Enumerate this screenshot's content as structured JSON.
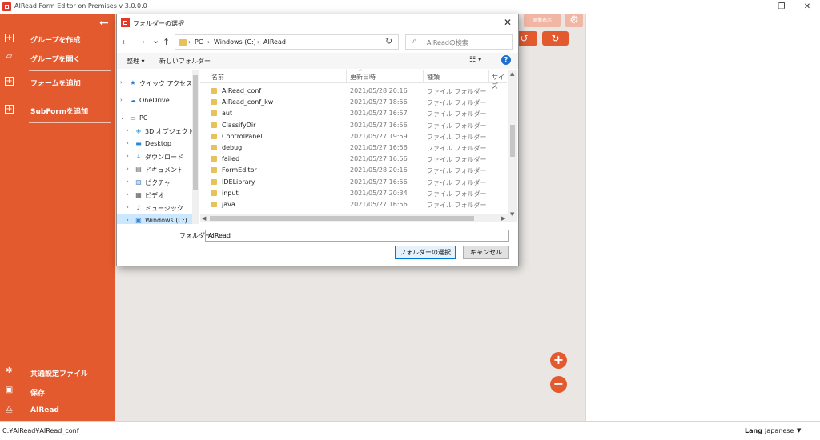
{
  "app": {
    "title": "AIRead Form Editor on Premises v 3.0.0.0",
    "window_controls": [
      "─",
      "❐",
      "✕"
    ]
  },
  "sidebar": {
    "back_glyph": "←",
    "items": [
      {
        "label": "グループを作成",
        "icon": "plus-box-icon"
      },
      {
        "label": "グループを開く",
        "icon": "folder-open-icon"
      },
      {
        "label": "フォームを追加",
        "icon": "plus-box-icon"
      },
      {
        "label": "SubFormを追加",
        "icon": "plus-box-icon"
      }
    ],
    "bottom": [
      {
        "label": "共通設定ファイル",
        "icon": "gear-icon"
      },
      {
        "label": "保存",
        "icon": "save-icon"
      },
      {
        "label": "AIRead",
        "icon": "airead-logo-icon"
      }
    ]
  },
  "toolbar": {
    "faded_button": "画像表示",
    "gear_glyph": "⚙",
    "undo_glyph": "↺",
    "redo_glyph": "↻",
    "zoom_in_glyph": "+",
    "zoom_out_glyph": "−"
  },
  "statusbar": {
    "path": "C:¥AIRead¥AIRead_conf",
    "lang_label": "Lang :",
    "lang_value": "Japanese",
    "dropdown_glyph": "▼"
  },
  "dialog": {
    "title": "フォルダーの選択",
    "close_glyph": "✕",
    "nav": {
      "back": "←",
      "forward": "→",
      "recent": "⌄",
      "up": "↑"
    },
    "breadcrumb": [
      "PC",
      "Windows (C:)",
      "AIRead"
    ],
    "crumb_sep": "›",
    "refresh_glyph": "↻",
    "search_glyph": "⌕",
    "search_placeholder": "AIReadの検索",
    "commands": {
      "organize": "整理 ▾",
      "new_folder": "新しいフォルダー",
      "view_glyph": "☷ ▾",
      "help_glyph": "?"
    },
    "tree": [
      {
        "label": "クイック アクセス",
        "icon": "★",
        "indent": 0,
        "expander": "›"
      },
      {
        "label": "OneDrive",
        "icon": "☁",
        "indent": 0,
        "expander": "›"
      },
      {
        "label": "PC",
        "icon": "▭",
        "indent": 0,
        "expander": "⌄"
      },
      {
        "label": "3D オブジェクト",
        "icon": "◈",
        "indent": 1,
        "expander": "›"
      },
      {
        "label": "Desktop",
        "icon": "▬",
        "indent": 1,
        "expander": "›"
      },
      {
        "label": "ダウンロード",
        "icon": "↓",
        "indent": 1,
        "expander": "›"
      },
      {
        "label": "ドキュメント",
        "icon": "▤",
        "indent": 1,
        "expander": "›"
      },
      {
        "label": "ピクチャ",
        "icon": "▨",
        "indent": 1,
        "expander": "›"
      },
      {
        "label": "ビデオ",
        "icon": "▦",
        "indent": 1,
        "expander": "›"
      },
      {
        "label": "ミュージック",
        "icon": "♪",
        "indent": 1,
        "expander": "›"
      },
      {
        "label": "Windows (C:)",
        "icon": "▣",
        "indent": 1,
        "expander": "›",
        "selected": true
      }
    ],
    "columns": [
      "名前",
      "更新日時",
      "種類",
      "サイズ"
    ],
    "sort_caret": "^",
    "rows": [
      {
        "name": "AIRead_conf",
        "date": "2021/05/28 20:16",
        "type": "ファイル フォルダー"
      },
      {
        "name": "AIRead_conf_kw",
        "date": "2021/05/27 18:56",
        "type": "ファイル フォルダー"
      },
      {
        "name": "aut",
        "date": "2021/05/27 16:57",
        "type": "ファイル フォルダー"
      },
      {
        "name": "ClassifyDir",
        "date": "2021/05/27 16:56",
        "type": "ファイル フォルダー"
      },
      {
        "name": "ControlPanel",
        "date": "2021/05/27 19:59",
        "type": "ファイル フォルダー"
      },
      {
        "name": "debug",
        "date": "2021/05/27 16:56",
        "type": "ファイル フォルダー"
      },
      {
        "name": "failed",
        "date": "2021/05/27 16:56",
        "type": "ファイル フォルダー"
      },
      {
        "name": "FormEditor",
        "date": "2021/05/28 20:16",
        "type": "ファイル フォルダー"
      },
      {
        "name": "IDELibrary",
        "date": "2021/05/27 16:56",
        "type": "ファイル フォルダー"
      },
      {
        "name": "input",
        "date": "2021/05/27 20:34",
        "type": "ファイル フォルダー"
      },
      {
        "name": "java",
        "date": "2021/05/27 16:56",
        "type": "ファイル フォルダー"
      }
    ],
    "scroll_glyphs": {
      "up": "▲",
      "down": "▼",
      "left": "◀",
      "right": "▶"
    },
    "folder_label": "フォルダー:",
    "folder_value": "AIRead",
    "select_button": "フォルダーの選択",
    "cancel_button": "キャンセル"
  }
}
